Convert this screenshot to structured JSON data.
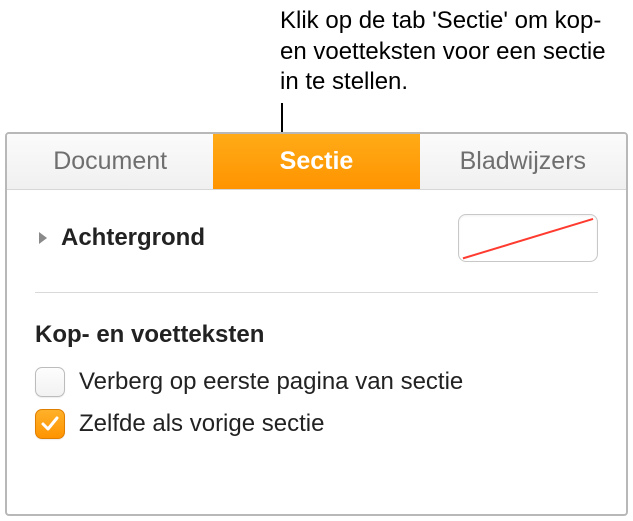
{
  "callout": "Klik op de tab 'Sectie' om kop- en voetteksten voor een sectie in te stellen.",
  "tabs": {
    "document": "Document",
    "sectie": "Sectie",
    "bladwijzers": "Bladwijzers"
  },
  "section": {
    "background_label": "Achtergrond",
    "headers_group_title": "Kop- en voetteksten",
    "hide_first_page_label": "Verberg op eerste pagina van sectie",
    "same_as_previous_label": "Zelfde als vorige sectie",
    "hide_first_page_checked": false,
    "same_as_previous_checked": true
  }
}
